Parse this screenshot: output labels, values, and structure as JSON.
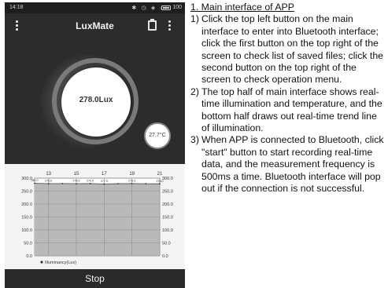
{
  "status_bar": {
    "time": "14:18",
    "icons": "✱ ◷ ◈ ᵢₗₗ",
    "battery": "100"
  },
  "app": {
    "title": "LuxMate",
    "illuminance": "278.0Lux",
    "temperature": "27.7°C",
    "stop_label": "Stop"
  },
  "chart_data": {
    "type": "line",
    "x_ticks": [
      "13",
      "15",
      "17",
      "19",
      "21"
    ],
    "y_ticks": [
      "0.0",
      "50.0",
      "100.0",
      "150.0",
      "200.0",
      "250.0",
      "300.0"
    ],
    "ylim": [
      0,
      300
    ],
    "legend": "Illuminancy(Lux)",
    "series": [
      {
        "name": "Illuminancy(Lux)",
        "x": [
          12,
          13,
          14,
          15,
          16,
          17,
          18,
          19,
          20,
          21
        ],
        "values": [
          280,
          278.6,
          279,
          278.5,
          279.0,
          277.5,
          278.4,
          279.0,
          278.3,
          278.0
        ],
        "labels": [
          "280.0",
          "278.6",
          "",
          "278.5",
          "279.0",
          "277.5",
          "",
          "278.3",
          "",
          "278.0"
        ]
      }
    ],
    "grid": true,
    "color": "#555555",
    "fill": "#b9b9b9"
  },
  "description": {
    "heading": "1. Main interface of APP",
    "items": [
      {
        "num": "1)",
        "text": "Click the top left button on the main interface to enter into Bluetooth interface; click the first button on the top right of the screen to check list of saved files; click the second button on the top right of the screen to check operation menu."
      },
      {
        "num": "2)",
        "text": "The top half of main interface shows real-time illumination and temperature, and the bottom half draws out real-time trend line of illumination."
      },
      {
        "num": "3)",
        "text": "When APP is connected to Bluetooth, click \"start\" button to start recording real-time data, and the measurement frequency is 500ms a time. Bluetooth  interface will pop out if the connection  is not successful."
      }
    ]
  }
}
